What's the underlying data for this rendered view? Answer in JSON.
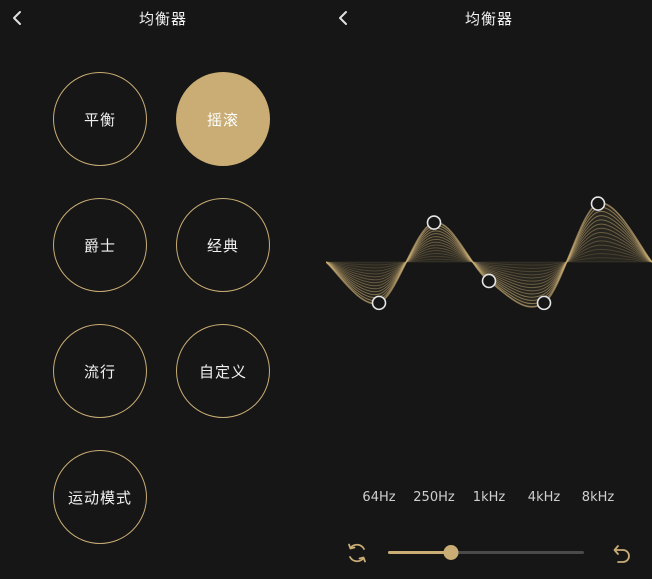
{
  "left_panel": {
    "title": "均衡器",
    "presets": [
      {
        "label": "平衡",
        "active": false
      },
      {
        "label": "摇滚",
        "active": true
      },
      {
        "label": "爵士",
        "active": false
      },
      {
        "label": "经典",
        "active": false
      },
      {
        "label": "流行",
        "active": false
      },
      {
        "label": "自定义",
        "active": false
      },
      {
        "label": "运动模式",
        "active": false
      }
    ]
  },
  "right_panel": {
    "title": "均衡器",
    "bands": [
      {
        "label": "64Hz",
        "level": 0.22
      },
      {
        "label": "250Hz",
        "level": 0.77
      },
      {
        "label": "1kHz",
        "level": 0.37
      },
      {
        "label": "4kHz",
        "level": 0.22
      },
      {
        "label": "8kHz",
        "level": 0.9
      }
    ],
    "intensity": 0.32
  },
  "icons": {
    "back": "chevron-left-icon",
    "reset": "refresh-icon",
    "undo": "undo-icon"
  },
  "colors": {
    "background": "#161616",
    "accent": "#c9ad74",
    "text": "#f0f0f0",
    "track": "#4a4a4a"
  }
}
